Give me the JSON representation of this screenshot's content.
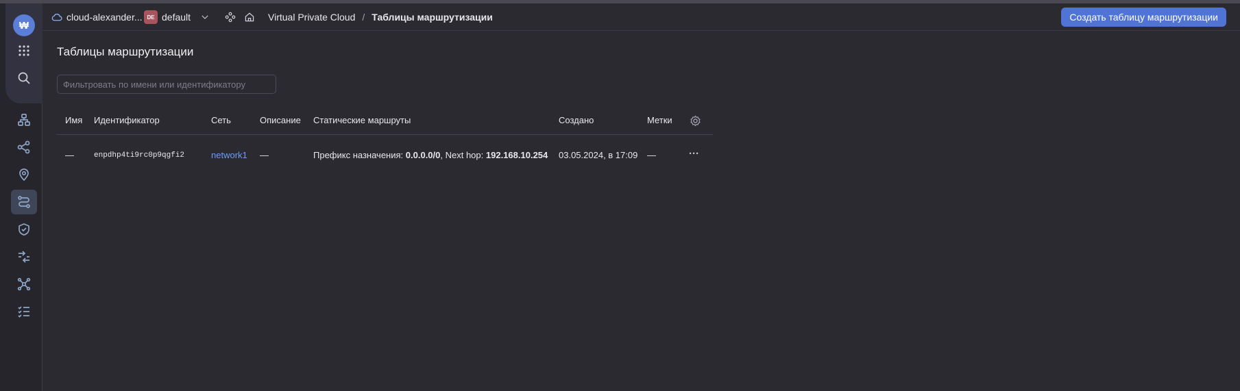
{
  "header": {
    "cloud_name": "cloud-alexander...",
    "folder_badge": "DE",
    "folder_name": "default",
    "breadcrumb_service": "Virtual Private Cloud",
    "breadcrumb_separator": "/",
    "breadcrumb_current": "Таблицы маршрутизации",
    "create_button": "Создать таблицу маршрутизации"
  },
  "sidebar": {
    "logo": "₩",
    "items": [
      "apps-icon",
      "search-icon",
      "network-icon",
      "connections-icon",
      "location-icon",
      "routes-icon",
      "security-icon",
      "transit-icon",
      "graph-icon",
      "checklist-icon"
    ],
    "active": "routes-icon"
  },
  "page": {
    "title": "Таблицы маршрутизации",
    "filter_placeholder": "Фильтровать по имени или идентификатору"
  },
  "table": {
    "columns": [
      "Имя",
      "Идентификатор",
      "Сеть",
      "Описание",
      "Статические маршруты",
      "Создано",
      "Метки"
    ],
    "rows": [
      {
        "name": "—",
        "id": "enpdhp4ti9rc0p9qgfi2",
        "network": "network1",
        "description": "—",
        "route_prefix_label": "Префикс назначения:",
        "route_prefix": "0.0.0.0/0",
        "route_hop_label": ", Next hop:",
        "route_hop": "192.168.10.254",
        "created": "03.05.2024, в 17:09",
        "labels": "—",
        "menu": "···"
      }
    ]
  },
  "colors": {
    "background": "#2b2a31",
    "accent": "#4f74d6",
    "link": "#6e9cf5",
    "badge": "#a9535f"
  }
}
